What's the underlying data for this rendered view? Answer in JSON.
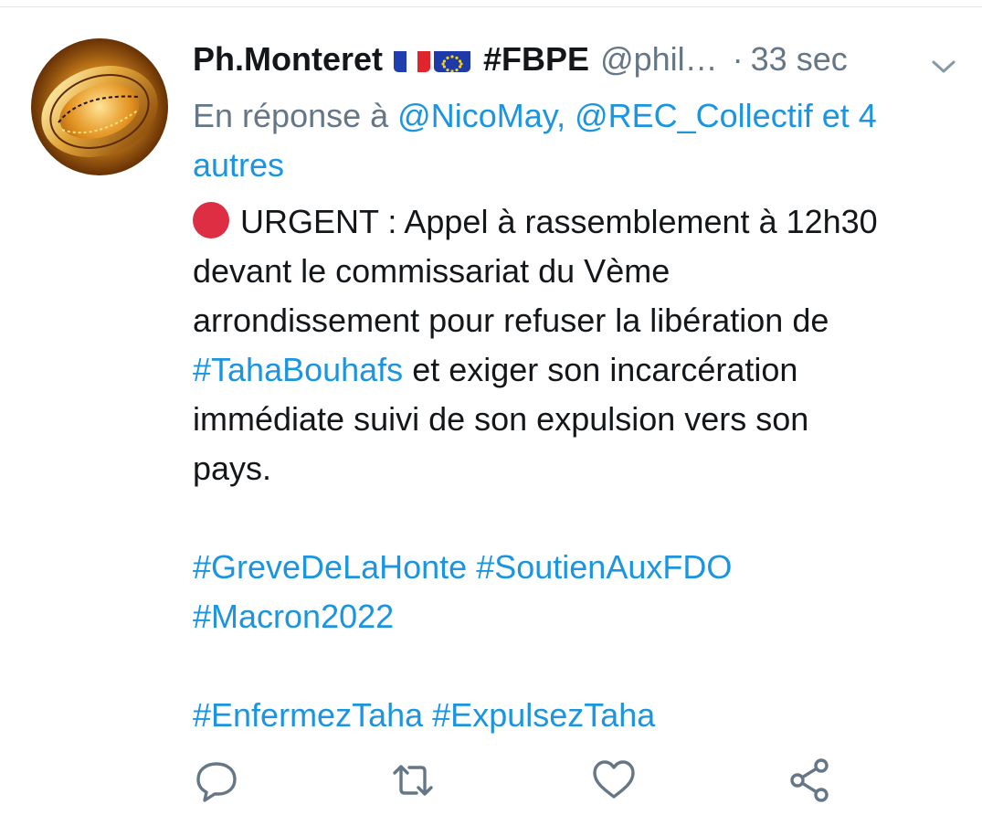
{
  "tweet": {
    "display_name": "Ph.Monteret",
    "name_hashtag": "#FBPE",
    "handle": "@phil…",
    "separator": "·",
    "time": "33 sec",
    "reply_prefix": "En réponse à",
    "reply_users": "@NicoMay, @REC_Collectif",
    "reply_joiner": "et",
    "reply_others": "4 autres",
    "body": {
      "line1_rest": "URGENT : Appel à rassemblement à 12h30",
      "line2": "devant le commissariat du Vème",
      "line3": "arrondissement pour refuser la libération de",
      "hashtag1": "#TahaBouhafs",
      "line4_rest": " et exiger son incarcération",
      "line5": "immédiate suivi de son expulsion vers son",
      "line6": "pays.",
      "tags_a1": "#GreveDeLaHonte",
      "tags_a2": "#SoutienAuxFDO",
      "tags_a3": "#Macron2022",
      "tags_b1": "#EnfermezTaha",
      "tags_b2": "#ExpulsezTaha"
    },
    "icons": {
      "flag1": "france-flag-icon",
      "flag2": "eu-flag-icon",
      "red_circle": "red-circle-emoji",
      "menu": "chevron-down-icon",
      "reply": "reply-icon",
      "retweet": "retweet-icon",
      "like": "heart-icon",
      "share": "share-icon"
    },
    "colors": {
      "link": "#1b95e0",
      "secondary": "#657786",
      "text": "#14171a",
      "red_dot": "#dd2e44"
    }
  }
}
